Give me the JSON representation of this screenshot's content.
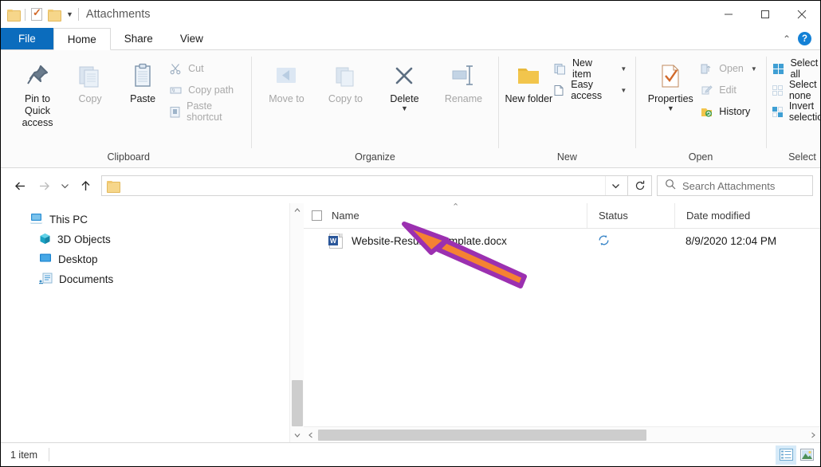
{
  "window": {
    "title": "Attachments",
    "quick_access": [
      "folder-icon",
      "properties-icon",
      "folder-icon",
      "dropdown-caret"
    ],
    "controls": {
      "minimize": "minimize-icon",
      "maximize": "maximize-icon",
      "close": "close-icon"
    }
  },
  "tabs": {
    "file": "File",
    "items": [
      "Home",
      "Share",
      "View"
    ],
    "active": "Home",
    "collapse_icon": "chevron-up-icon",
    "help_label": "?"
  },
  "ribbon": {
    "groups": [
      {
        "label": "Clipboard",
        "big_buttons": [
          {
            "label": "Pin to Quick access",
            "icon": "pin-icon",
            "dim": false
          },
          {
            "label": "Copy",
            "icon": "copy-icon",
            "dim": true
          },
          {
            "label": "Paste",
            "icon": "paste-icon",
            "dim": false
          }
        ],
        "small_buttons": [
          {
            "label": "Cut",
            "icon": "scissors-icon",
            "dim": true
          },
          {
            "label": "Copy path",
            "icon": "copy-path-icon",
            "dim": true
          },
          {
            "label": "Paste shortcut",
            "icon": "paste-shortcut-icon",
            "dim": true
          }
        ]
      },
      {
        "label": "Organize",
        "big_buttons": [
          {
            "label": "Move to",
            "icon": "move-to-icon",
            "dim": true,
            "caret": true
          },
          {
            "label": "Copy to",
            "icon": "copy-to-icon",
            "dim": true,
            "caret": true
          },
          {
            "label": "Delete",
            "icon": "delete-icon",
            "dim": false,
            "caret": true
          },
          {
            "label": "Rename",
            "icon": "rename-icon",
            "dim": true
          }
        ],
        "small_buttons": []
      },
      {
        "label": "New",
        "big_buttons": [
          {
            "label": "New folder",
            "icon": "new-folder-icon",
            "dim": false
          }
        ],
        "small_buttons": [
          {
            "label": "New item",
            "icon": "new-item-icon",
            "dim": false,
            "caret": true
          },
          {
            "label": "Easy access",
            "icon": "easy-access-icon",
            "dim": false,
            "caret": true
          }
        ]
      },
      {
        "label": "Open",
        "big_buttons": [
          {
            "label": "Properties",
            "icon": "properties-icon",
            "dim": false,
            "caret": true
          }
        ],
        "small_buttons": [
          {
            "label": "Open",
            "icon": "open-icon",
            "dim": true,
            "caret": true
          },
          {
            "label": "Edit",
            "icon": "edit-icon",
            "dim": true
          },
          {
            "label": "History",
            "icon": "history-icon",
            "dim": false
          }
        ]
      },
      {
        "label": "Select",
        "big_buttons": [],
        "small_buttons": [
          {
            "label": "Select all",
            "icon": "select-all-icon",
            "dim": false
          },
          {
            "label": "Select none",
            "icon": "select-none-icon",
            "dim": false
          },
          {
            "label": "Invert selection",
            "icon": "invert-selection-icon",
            "dim": false
          }
        ]
      }
    ]
  },
  "addressbar": {
    "back_icon": "arrow-left-icon",
    "forward_icon": "arrow-right-icon",
    "recent_icon": "chevron-down-icon",
    "up_icon": "arrow-up-icon",
    "path": "",
    "dropdown_icon": "chevron-down-icon",
    "refresh_icon": "refresh-icon"
  },
  "search": {
    "placeholder": "Search Attachments",
    "icon": "search-icon"
  },
  "navpane": {
    "items": [
      {
        "label": "This PC",
        "icon": "this-pc-icon",
        "indent": false
      },
      {
        "label": "3D Objects",
        "icon": "3d-objects-icon",
        "indent": true
      },
      {
        "label": "Desktop",
        "icon": "desktop-icon",
        "indent": true
      },
      {
        "label": "Documents",
        "icon": "documents-icon",
        "indent": true
      }
    ]
  },
  "filelist": {
    "columns": [
      "Name",
      "Status",
      "Date modified"
    ],
    "sort_indicator": "ascending",
    "rows": [
      {
        "name": "Website-Resume-Template.docx",
        "icon": "word-document-icon",
        "status": "sync-icon",
        "date_modified": "8/9/2020 12:04 PM"
      }
    ]
  },
  "statusbar": {
    "item_count": "1 item",
    "views": [
      {
        "name": "details-view",
        "selected": true
      },
      {
        "name": "large-icons-view",
        "selected": false
      }
    ]
  },
  "annotation": {
    "type": "arrow",
    "fill": "#F58232",
    "stroke": "#9B30B0",
    "points_at": "Website-Resume-Template.docx"
  }
}
